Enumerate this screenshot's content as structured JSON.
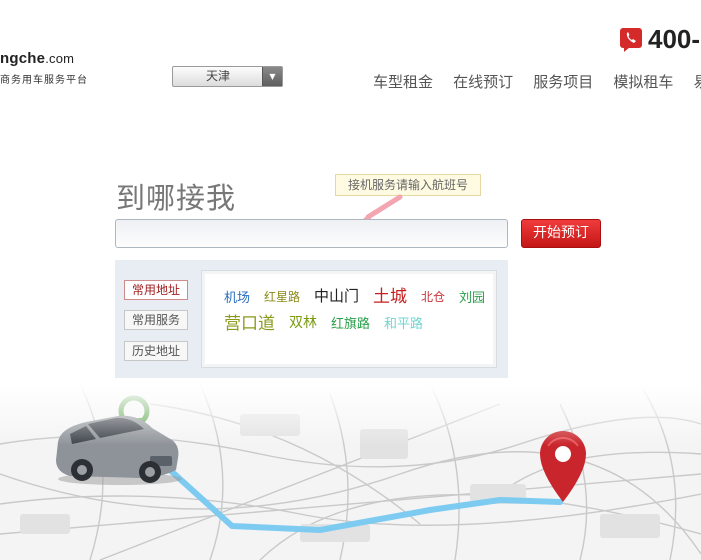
{
  "logo": {
    "text_main": "ngche",
    "text_domain": ".com",
    "tagline": "商务用车服务平台"
  },
  "city_select": {
    "value": "天津"
  },
  "phone": {
    "number": "400-"
  },
  "nav": {
    "items": [
      "车型租金",
      "在线预订",
      "服务项目",
      "模拟租车",
      "易"
    ]
  },
  "search": {
    "title": "到哪接我",
    "tooltip": "接机服务请输入航班号",
    "input_value": "",
    "button_label": "开始预订"
  },
  "tabs": [
    "常用地址",
    "常用服务",
    "历史地址"
  ],
  "addresses": [
    {
      "label": "机场",
      "color": "#2a6fbf"
    },
    {
      "label": "红星路",
      "color": "#8a8a1a"
    },
    {
      "label": "中山门",
      "color": "#222222"
    },
    {
      "label": "土城",
      "color": "#c81e1e"
    },
    {
      "label": "北仓",
      "color": "#c8323c"
    },
    {
      "label": "刘园",
      "color": "#2aa04a"
    },
    {
      "label": "营口道",
      "color": "#8a9a1a"
    },
    {
      "label": "双林",
      "color": "#7a9a10"
    },
    {
      "label": "红旗路",
      "color": "#2aa04a"
    },
    {
      "label": "和平路",
      "color": "#6fd6d0"
    }
  ],
  "colors": {
    "accent_red": "#d42020",
    "route_blue": "#7ecbf2",
    "pin_red": "#c9252c",
    "pin_green": "#5aa34a"
  }
}
